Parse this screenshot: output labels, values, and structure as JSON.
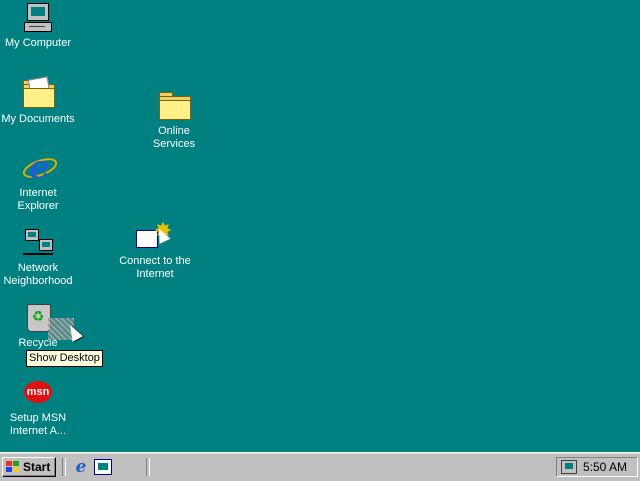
{
  "desktop": {
    "icons": [
      {
        "label": "My Computer"
      },
      {
        "label": "My Documents"
      },
      {
        "label": "Internet\nExplorer"
      },
      {
        "label": "Network\nNeighborhood"
      },
      {
        "label": "Recycle"
      },
      {
        "label": "Setup MSN\nInternet A..."
      },
      {
        "label": "Online\nServices"
      },
      {
        "label": "Connect to the\nInternet"
      }
    ],
    "tooltip": "Show Desktop",
    "background_color": "#008080"
  },
  "taskbar": {
    "start_label": "Start",
    "quick_launch": [
      {
        "icon": "internet-explorer-icon"
      },
      {
        "icon": "show-desktop-icon"
      }
    ],
    "clock": "5:50 AM"
  }
}
